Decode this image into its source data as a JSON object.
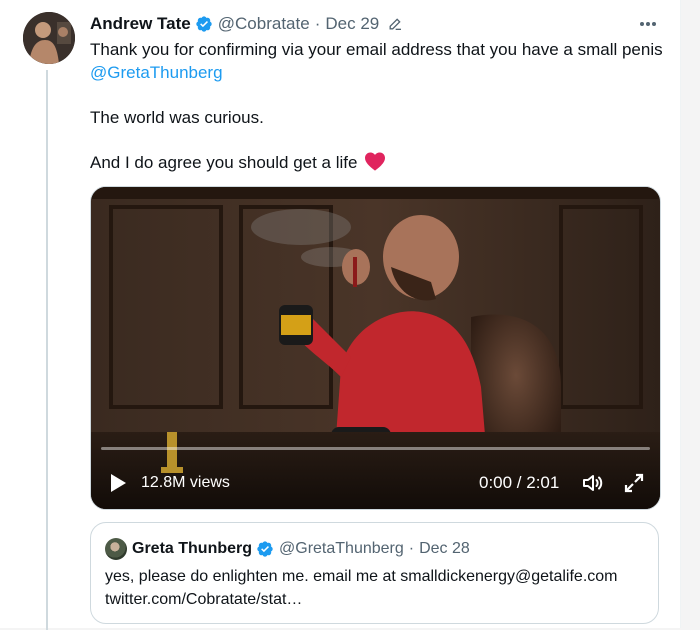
{
  "tweet": {
    "author_name": "Andrew Tate",
    "handle": "@Cobratate",
    "separator": "·",
    "date": "Dec 29",
    "lines": {
      "line1": "Thank you for confirming via your email address that you have a small penis",
      "mention": "@GretaThunberg",
      "line2": "The world was curious.",
      "line3": "And I do agree you should get a life"
    },
    "icons": {
      "verified": "verified-badge-icon",
      "edit": "edit-pencil-icon",
      "more": "more-options-icon",
      "heart": "red-heart-icon"
    },
    "colors": {
      "link": "#1d9bf0",
      "verified": "#1d9bf0",
      "heart": "#e0245e",
      "secondary_text": "#536471"
    }
  },
  "video": {
    "views": "12.8M views",
    "time": "0:00 / 2:01",
    "progress": 0.0,
    "icons": {
      "play": "play-icon",
      "volume": "volume-icon",
      "fullscreen": "fullscreen-icon"
    }
  },
  "quote": {
    "author_name": "Greta Thunberg",
    "handle": "@GretaThunberg",
    "separator": "·",
    "date": "Dec 28",
    "text_line1": "yes, please do enlighten me. email me at smalldickenergy@getalife.com",
    "text_line2": "twitter.com/Cobratate/stat…"
  }
}
